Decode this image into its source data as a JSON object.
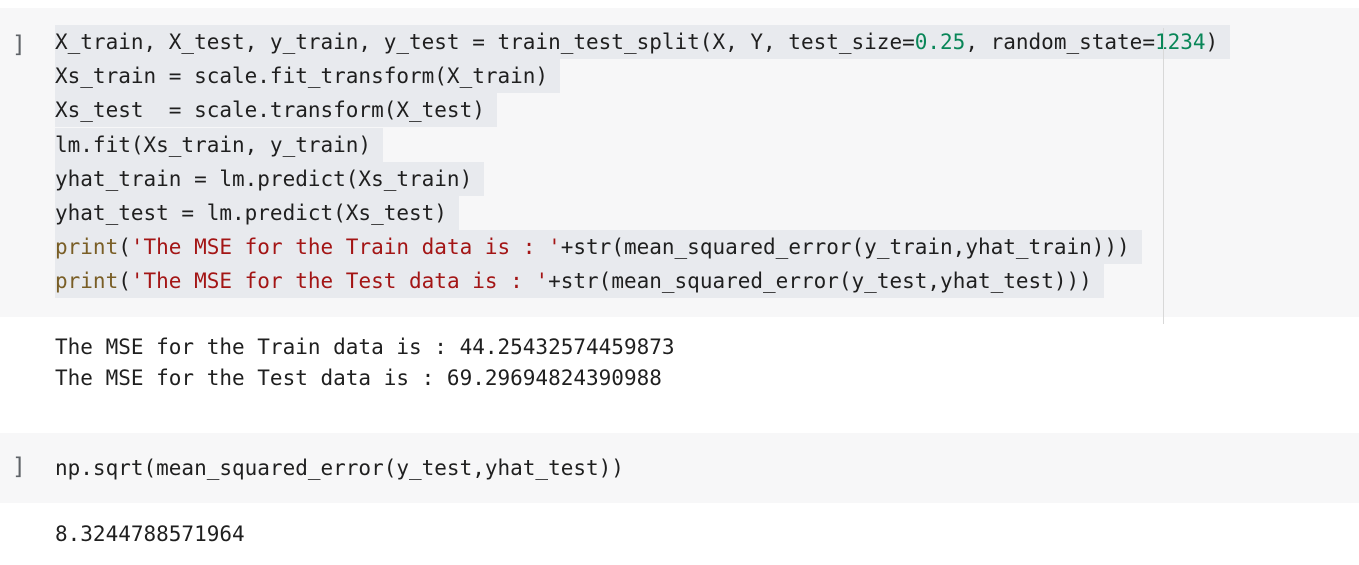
{
  "cell1": {
    "bracket": "]",
    "lines": [
      [
        {
          "t": "X_train, X_test, y_train, y_test = train_test_split(X, Y, test_size=",
          "c": ""
        },
        {
          "t": "0.25",
          "c": "k-num"
        },
        {
          "t": ", random_state=",
          "c": ""
        },
        {
          "t": "1234",
          "c": "k-num"
        },
        {
          "t": ")",
          "c": ""
        }
      ],
      [
        {
          "t": "Xs_train = scale.fit_transform(X_train)",
          "c": ""
        }
      ],
      [
        {
          "t": "Xs_test  = scale.transform(X_test)",
          "c": ""
        }
      ],
      [
        {
          "t": "lm.fit(Xs_train, y_train)",
          "c": ""
        }
      ],
      [
        {
          "t": "yhat_train = lm.predict(Xs_train)",
          "c": ""
        }
      ],
      [
        {
          "t": "yhat_test = lm.predict(Xs_test)",
          "c": ""
        }
      ],
      [
        {
          "t": "print",
          "c": "k-builtin"
        },
        {
          "t": "(",
          "c": ""
        },
        {
          "t": "'The MSE for the Train data is : '",
          "c": "k-str"
        },
        {
          "t": "+str(mean_squared_error(y_train,yhat_train)))",
          "c": ""
        }
      ],
      [
        {
          "t": "print",
          "c": "k-builtin"
        },
        {
          "t": "(",
          "c": ""
        },
        {
          "t": "'The MSE for the Test data is : '",
          "c": "k-str"
        },
        {
          "t": "+str(mean_squared_error(y_test,yhat_test)))",
          "c": ""
        }
      ]
    ],
    "output": [
      "The MSE for the Train data is : 44.25432574459873",
      "The MSE for the Test data is : 69.29694824390988"
    ]
  },
  "cell2": {
    "bracket": "]",
    "line": "np.sqrt(mean_squared_error(y_test,yhat_test))",
    "output": "8.3244788571964"
  }
}
